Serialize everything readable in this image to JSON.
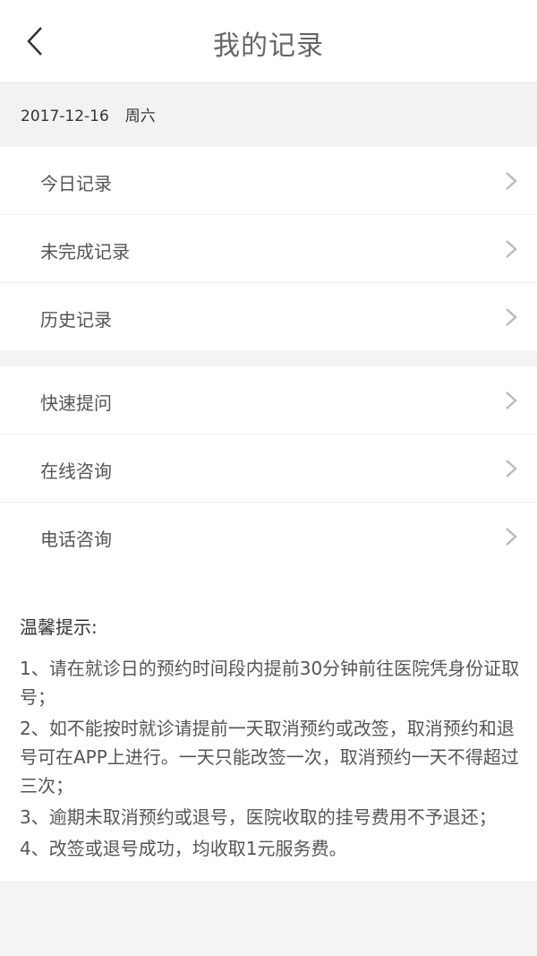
{
  "header": {
    "title": "我的记录",
    "back_icon": "chevron-left-icon"
  },
  "date": {
    "value": "2017-12-16",
    "weekday": "周六"
  },
  "menu_group_1": [
    {
      "label": "今日记录",
      "icon": "chevron-right-icon"
    },
    {
      "label": "未完成记录",
      "icon": "chevron-right-icon"
    },
    {
      "label": "历史记录",
      "icon": "chevron-right-icon"
    }
  ],
  "menu_group_2": [
    {
      "label": "快速提问",
      "icon": "chevron-right-icon"
    },
    {
      "label": "在线咨询",
      "icon": "chevron-right-icon"
    },
    {
      "label": "电话咨询",
      "icon": "chevron-right-icon"
    }
  ],
  "tips": {
    "title": "温馨提示:",
    "items": [
      "1、请在就诊日的预约时间段内提前30分钟前往医院凭身份证取号；",
      "2、如不能按时就诊请提前一天取消预约或改签，取消预约和退号可在APP上进行。一天只能改签一次，取消预约一天不得超过三次；",
      "3、逾期未取消预约或退号，医院收取的挂号费用不予退还；",
      "4、改签或退号成功，均收取1元服务费。"
    ]
  }
}
